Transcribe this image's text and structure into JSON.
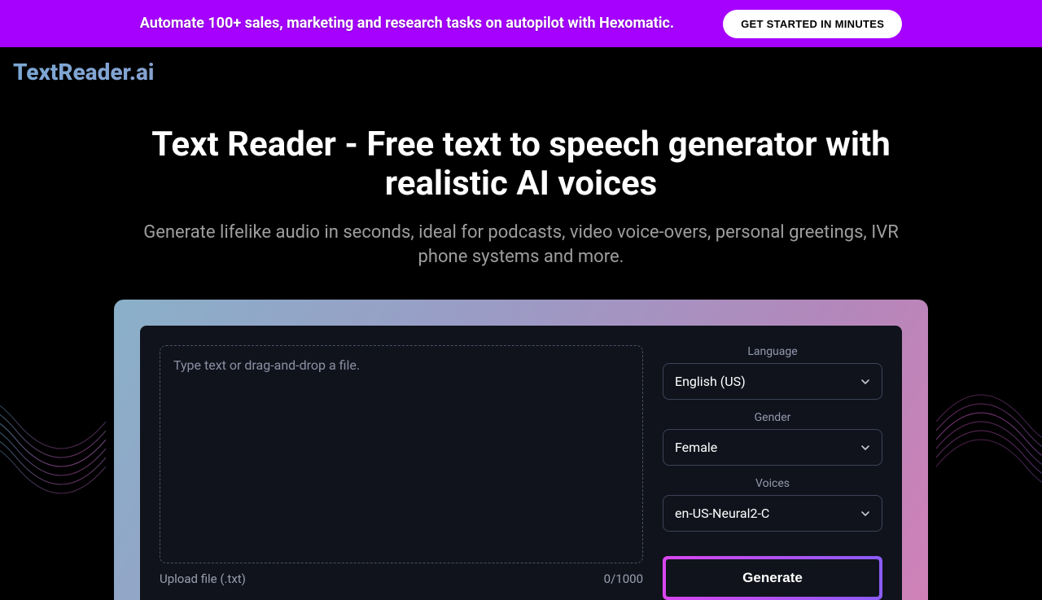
{
  "banner": {
    "text": "Automate 100+ sales, marketing and research tasks on autopilot with Hexomatic.",
    "cta": "GET STARTED IN MINUTES"
  },
  "logo": "TextReader.ai",
  "hero": {
    "title": "Text Reader - Free text to speech generator with realistic AI voices",
    "subtitle": "Generate lifelike audio in seconds, ideal for podcasts, video voice-overs, personal greetings, IVR phone systems and more."
  },
  "tool": {
    "textarea_placeholder": "Type text or drag-and-drop a file.",
    "upload_label": "Upload file (.txt)",
    "counter": "0/1000",
    "language_label": "Language",
    "language_value": "English (US)",
    "gender_label": "Gender",
    "gender_value": "Female",
    "voices_label": "Voices",
    "voices_value": "en-US-Neural2-C",
    "generate_label": "Generate"
  }
}
